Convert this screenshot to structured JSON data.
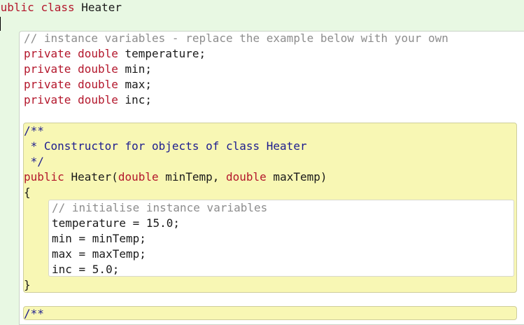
{
  "editor": {
    "class_decl": {
      "kw_public": "public",
      "kw_class": "class",
      "name": "Heater"
    },
    "open_brace": "{",
    "comment_fields": "// instance variables - replace the example below with your own",
    "fields": [
      {
        "access": "private",
        "type": "double",
        "name": "temperature;"
      },
      {
        "access": "private",
        "type": "double",
        "name": "min;"
      },
      {
        "access": "private",
        "type": "double",
        "name": "max;"
      },
      {
        "access": "private",
        "type": "double",
        "name": "inc;"
      }
    ],
    "constructor": {
      "javadoc": [
        "/**",
        " * Constructor for objects of class Heater",
        " */"
      ],
      "kw_public": "public",
      "name": "Heater(",
      "param1_type": "double",
      "param1_name": " minTemp, ",
      "param2_type": "double",
      "param2_name": " maxTemp)",
      "open_brace": "{",
      "body_comment": "// initialise instance variables",
      "statements": [
        "temperature = 15.0;",
        "min = minTemp;",
        "max = maxTemp;",
        "inc = 5.0;"
      ],
      "close_brace": "}"
    },
    "next_doc_start": "/**"
  }
}
